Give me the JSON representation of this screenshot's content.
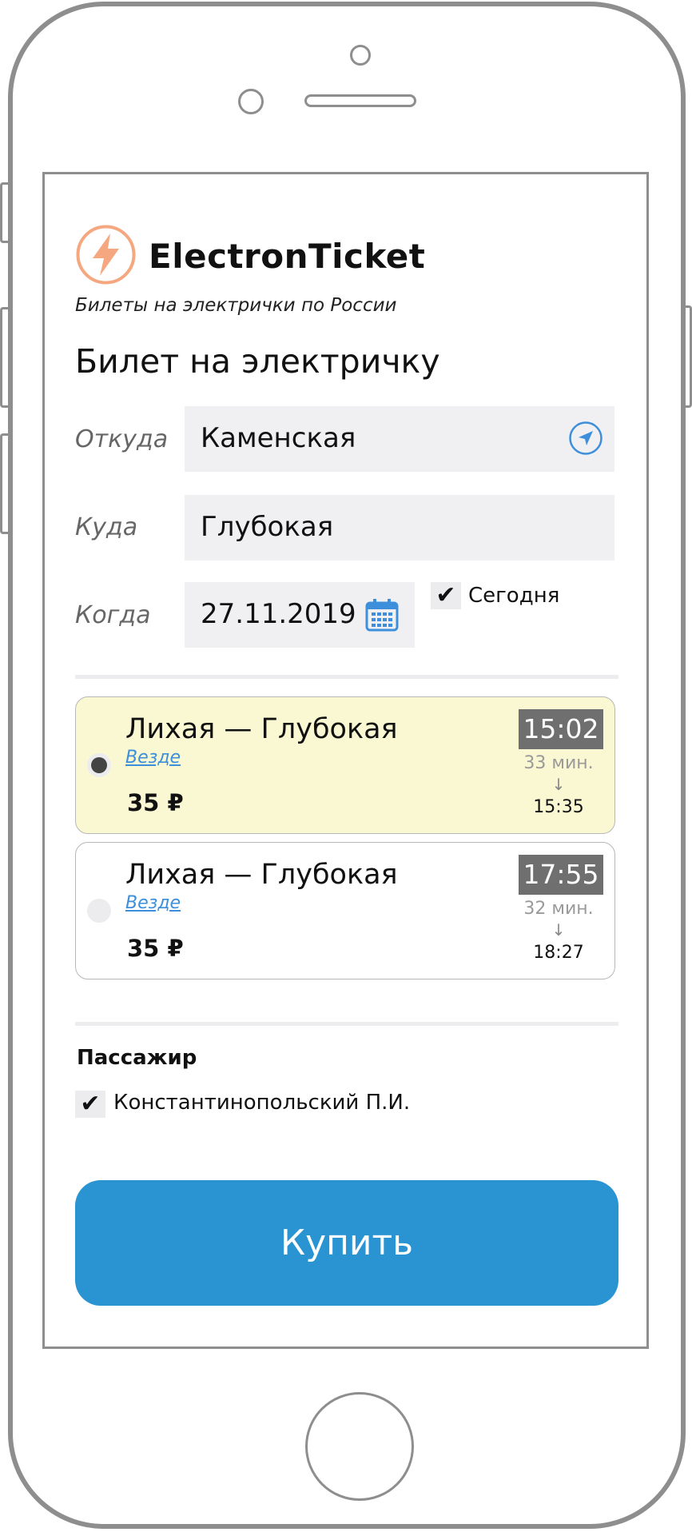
{
  "app": {
    "name": "ElectronTicket",
    "tagline": "Билеты на электрички по России",
    "logo_icon": "lightning-bolt-icon",
    "logo_color": "#f5a880"
  },
  "page_title": "Билет на электричку",
  "form": {
    "from": {
      "label": "Откуда",
      "value": "Каменская",
      "icon": "location-arrow-icon"
    },
    "to": {
      "label": "Куда",
      "value": "Глубокая"
    },
    "when": {
      "label": "Когда",
      "value": "27.11.2019",
      "icon": "calendar-icon"
    },
    "today": {
      "label": "Сегодня",
      "checked": true,
      "mark": "✔"
    }
  },
  "trips": [
    {
      "route": "Лихая — Глубокая",
      "link": "Везде",
      "price": "35 ₽",
      "departure": "15:02",
      "duration": "33 мин.",
      "arrow": "↓",
      "arrival": "15:35",
      "selected": true
    },
    {
      "route": "Лихая — Глубокая",
      "link": "Везде",
      "price": "35 ₽",
      "departure": "17:55",
      "duration": "32 мин.",
      "arrow": "↓",
      "arrival": "18:27",
      "selected": false
    }
  ],
  "passenger": {
    "title": "Пассажир",
    "name": "Константинопольский П.И.",
    "checked": true,
    "mark": "✔"
  },
  "buy_button": "Купить",
  "colors": {
    "accent": "#2a93d2",
    "selected_card": "#faf8d2",
    "link": "#3d8fdb",
    "field_bg": "#f0f0f3"
  }
}
